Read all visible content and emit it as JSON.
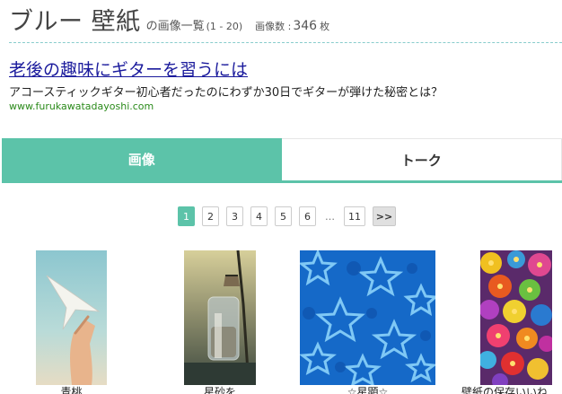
{
  "header": {
    "title": "ブルー 壁紙",
    "subtitle": "の画像一覧",
    "range": "(1 - 20)",
    "count_label": "画像数 :",
    "count_value": "346",
    "count_unit": "枚"
  },
  "ad": {
    "title": "老後の趣味にギターを習うには",
    "description": "アコースティックギター初心者だったのにわずか30日でギターが弾けた秘密とは？",
    "url": "www.furukawatadayoshi.com"
  },
  "tabs": [
    {
      "label": "画像",
      "active": true
    },
    {
      "label": "トーク",
      "active": false
    }
  ],
  "pagination": {
    "pages": [
      "1",
      "2",
      "3",
      "4",
      "5",
      "6"
    ],
    "ellipsis": "…",
    "last": "11",
    "next": ">>",
    "current": "1"
  },
  "images": [
    {
      "caption": "青桃",
      "subject": "paper airplane in hand against sky"
    },
    {
      "caption": "星砂を",
      "subject": "glass bottle with sand and string"
    },
    {
      "caption": "☆星顕☆",
      "subject": "blue stars pattern"
    },
    {
      "caption": "壁紙の保存いいね",
      "subject": "colorful flowers"
    }
  ],
  "colors": {
    "accent": "#5cc3a9",
    "link": "#1a1a9c",
    "ad_url": "#2a8a1a"
  }
}
